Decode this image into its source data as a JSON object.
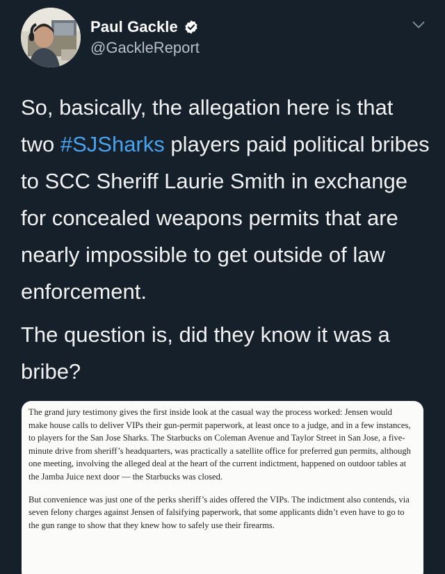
{
  "author": {
    "display_name": "Paul Gackle",
    "handle": "@GackleReport",
    "verified": true,
    "avatar": "avatar-photo"
  },
  "icons": {
    "verified": "verified-badge-icon",
    "menu": "chevron-down-icon"
  },
  "tweet": {
    "para1_before": "So, basically, the allegation here is that two ",
    "hashtag": "#SJSharks",
    "para1_after": " players paid political bribes to SCC Sheriff Laurie Smith in exchange for concealed weapons permits that are nearly impossible to get outside of law enforcement.",
    "para2": "The question is, did they know it was a bribe?"
  },
  "article_excerpt": {
    "paragraph1": "The grand jury testimony gives the first inside look at the casual way the process worked: Jensen would make house calls to deliver VIPs their gun-permit paperwork, at least once to a judge, and in a few instances, to players for the San Jose Sharks. The Starbucks on Coleman Avenue and Taylor Street in San Jose, a five-minute drive from sheriff’s headquarters, was practically a satellite office for preferred gun permits, although one meeting, involving the alleged deal at the heart of the current indictment, happened on outdoor tables at the Jamba Juice next door — the Starbucks was closed.",
    "paragraph2": "But convenience was just one of the perks sheriff’s aides offered the VIPs. The indictment also contends, via seven felony charges against Jensen of falsifying paperwork, that some applicants didn’t even have to go to the gun range to show that they knew how to safely use their firearms."
  },
  "colors": {
    "background": "#15202b",
    "hashtag": "#4aa3ef",
    "verified_badge": "#ffffff",
    "card_background": "#fbfbfa"
  }
}
